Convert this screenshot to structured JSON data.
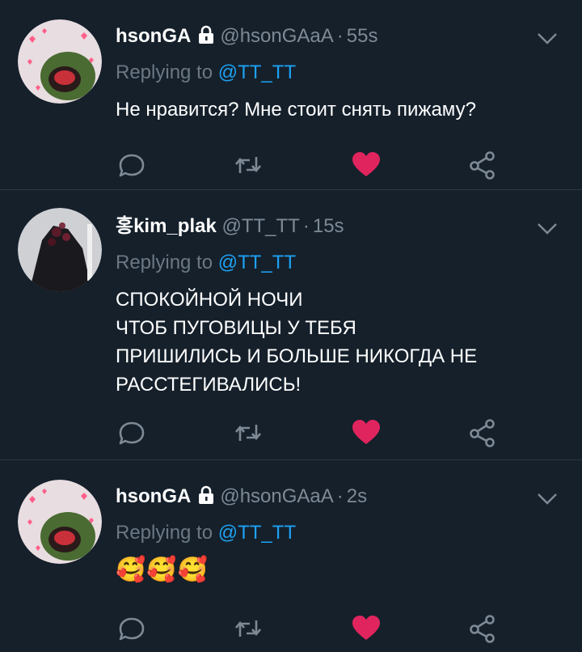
{
  "colors": {
    "background": "#15202b",
    "divider": "#2b3743",
    "muted": "#7d8a96",
    "mention": "#1da1f2",
    "like": "#e0245e"
  },
  "tweets": [
    {
      "name": "hsonGA",
      "locked": true,
      "handle": "@hsonGAaA",
      "time": "55s",
      "reply_prefix": "Replying to",
      "reply_mention": "@TT_TT",
      "body_lines": [
        "Не нравится? Мне стоит снять пижаму?"
      ],
      "liked": true
    },
    {
      "name": "홍kim_plak",
      "locked": false,
      "handle": "@TT_TT",
      "time": "15s",
      "reply_prefix": "Replying to",
      "reply_mention": "@TT_TT",
      "body_lines": [
        "СПОКОЙНОЙ НОЧИ",
        "ЧТОБ ПУГОВИЦЫ У ТЕБЯ",
        "ПРИШИЛИСЬ И БОЛЬШЕ НИКОГДА НЕ",
        "РАССТЕГИВАЛИСЬ!"
      ],
      "liked": true
    },
    {
      "name": "hsonGA",
      "locked": true,
      "handle": "@hsonGAaA",
      "time": "2s",
      "reply_prefix": "Replying to",
      "reply_mention": "@TT_TT",
      "body_lines": [
        "🥰🥰🥰"
      ],
      "liked": true
    }
  ],
  "icons": {
    "reply": "speech-bubble-icon",
    "retweet": "retweet-icon",
    "like": "heart-icon",
    "share": "share-icon",
    "menu": "chevron-down-icon",
    "lock": "lock-icon"
  }
}
